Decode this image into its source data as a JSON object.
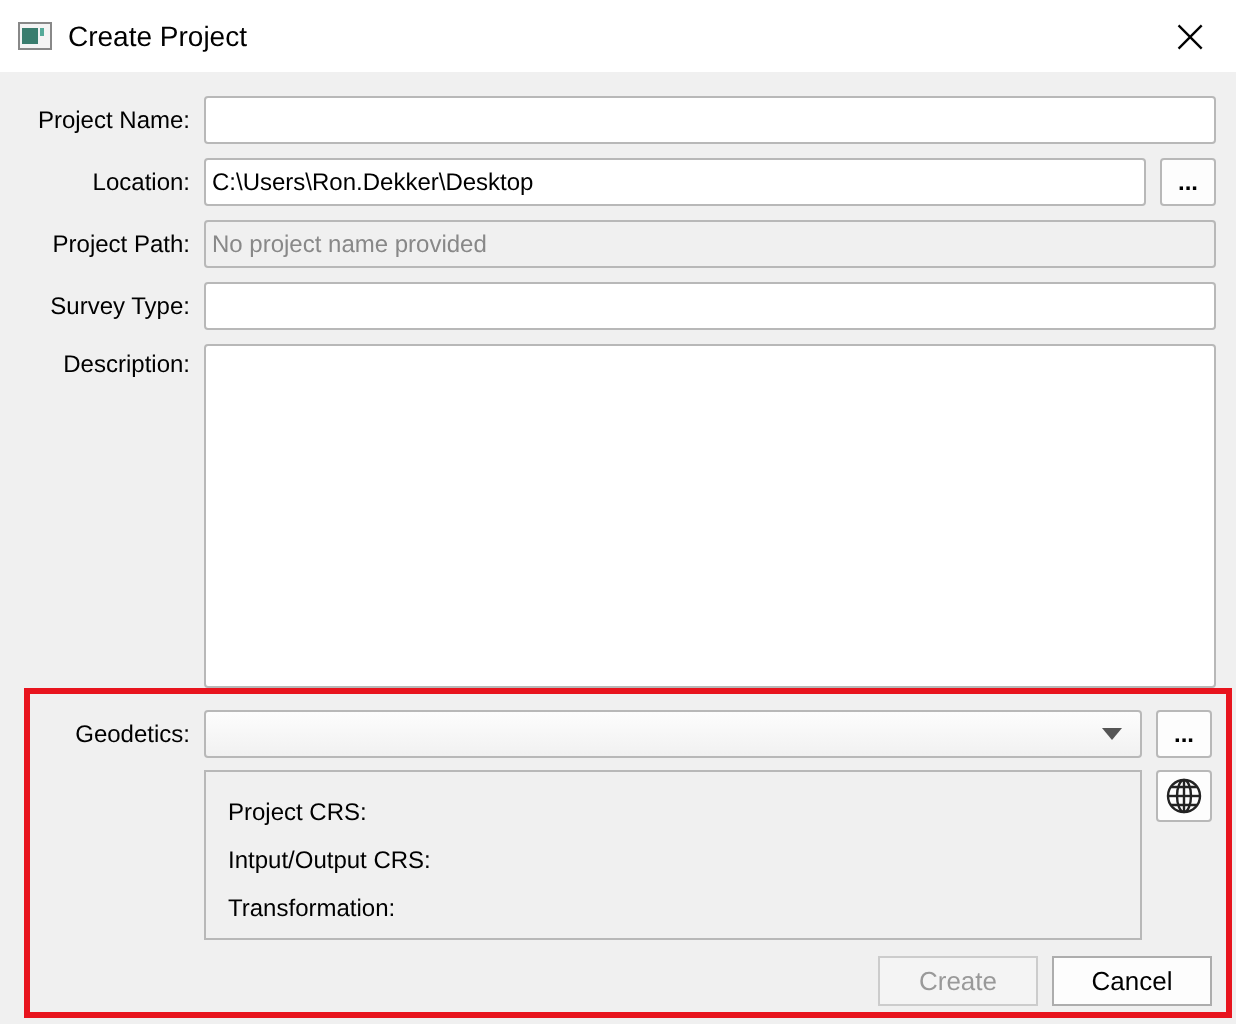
{
  "window": {
    "title": "Create Project",
    "close": "×"
  },
  "fields": [
    {
      "label": "Project Name:",
      "kind": "text"
    },
    {
      "label": "Location:",
      "kind": "text",
      "value": "C:\\Users\\Ron.Dekker\\Desktop",
      "browse_label": "..."
    },
    {
      "label": "Project Path:",
      "kind": "text",
      "placeholder": "No project name provided",
      "disabled": true
    },
    {
      "label": "Survey Type:",
      "kind": "text"
    },
    {
      "label": "Description:",
      "kind": "textarea"
    }
  ],
  "geodetics": {
    "label": "Geodetics:",
    "browse_label": "...",
    "info": [
      "Project CRS:",
      "Intput/Output CRS:",
      "Transformation:"
    ]
  },
  "buttons": [
    {
      "label": "Create",
      "disabled": true
    },
    {
      "label": "Cancel",
      "disabled": false
    }
  ]
}
